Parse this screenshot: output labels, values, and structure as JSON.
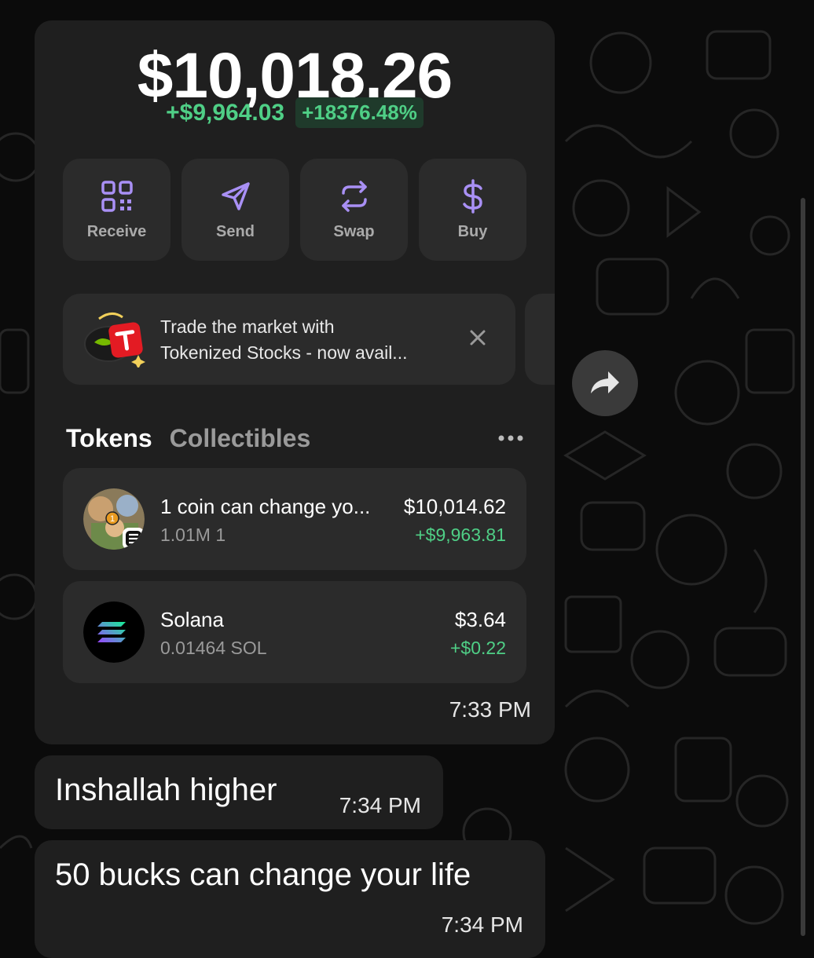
{
  "chat": {
    "messages": [
      {
        "type": "image",
        "time": "7:33 PM",
        "wallet": {
          "balance": "$10,018.26",
          "change_abs": "+$9,964.03",
          "change_pct": "+18376.48%",
          "actions": [
            {
              "label": "Receive",
              "icon": "qr-code-icon"
            },
            {
              "label": "Send",
              "icon": "send-icon"
            },
            {
              "label": "Swap",
              "icon": "swap-icon"
            },
            {
              "label": "Buy",
              "icon": "dollar-icon"
            }
          ],
          "promo": {
            "line1": "Trade the market with",
            "line2": "Tokenized Stocks - now avail..."
          },
          "tabs": [
            "Tokens",
            "Collectibles"
          ],
          "tokens": [
            {
              "name": "1 coin can change yo...",
              "amount": "1.01M 1",
              "value": "$10,014.62",
              "gain": "+$9,963.81",
              "badge": "1"
            },
            {
              "name": "Solana",
              "amount": "0.01464 SOL",
              "value": "$3.64",
              "gain": "+$0.22"
            }
          ]
        }
      },
      {
        "type": "text",
        "text": "Inshallah higher",
        "time": "7:34 PM"
      },
      {
        "type": "text",
        "text": "50 bucks can change your life",
        "time": "7:34 PM"
      }
    ]
  },
  "colors": {
    "background": "#0b0b0b",
    "bubble": "#1f1f1f",
    "card": "#2b2b2b",
    "positive": "#4fcf86",
    "accent": "#a990f5"
  }
}
